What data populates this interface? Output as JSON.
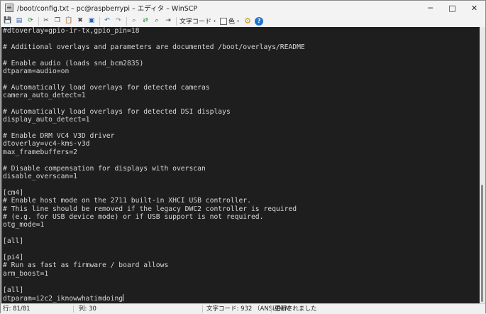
{
  "window": {
    "title": "/boot/config.txt – pc@raspberrypi – エディタ – WinSCP",
    "minimize_glyph": "─",
    "maximize_glyph": "□",
    "close_glyph": "✕"
  },
  "toolbar": {
    "buttons": [
      {
        "name": "save-icon",
        "glyph": "💾"
      },
      {
        "name": "save-all-icon",
        "glyph": "▤"
      },
      {
        "name": "reload-icon",
        "glyph": "⟳"
      },
      {
        "name": "cut-icon",
        "glyph": "✂"
      },
      {
        "name": "copy-icon",
        "glyph": "❐"
      },
      {
        "name": "paste-icon",
        "glyph": "📋"
      },
      {
        "name": "delete-icon",
        "glyph": "✖"
      },
      {
        "name": "select-all-icon",
        "glyph": "▣"
      },
      {
        "name": "undo-icon",
        "glyph": "↶"
      },
      {
        "name": "redo-icon",
        "glyph": "↷"
      },
      {
        "name": "find-icon",
        "glyph": "⌕"
      },
      {
        "name": "replace-icon",
        "glyph": "⇄"
      },
      {
        "name": "find-next-icon",
        "glyph": "⌕"
      },
      {
        "name": "goto-line-icon",
        "glyph": "⇥"
      }
    ],
    "encoding_label": "文字コード・",
    "color_label": "色・",
    "settings_glyph": "⚙",
    "help_glyph": "?"
  },
  "editor": {
    "lines": [
      "#dtoverlay=gpio-ir-tx,gpio_pin=18",
      "",
      "# Additional overlays and parameters are documented /boot/overlays/README",
      "",
      "# Enable audio (loads snd_bcm2835)",
      "dtparam=audio=on",
      "",
      "# Automatically load overlays for detected cameras",
      "camera_auto_detect=1",
      "",
      "# Automatically load overlays for detected DSI displays",
      "display_auto_detect=1",
      "",
      "# Enable DRM VC4 V3D driver",
      "dtoverlay=vc4-kms-v3d",
      "max_framebuffers=2",
      "",
      "# Disable compensation for displays with overscan",
      "disable_overscan=1",
      "",
      "[cm4]",
      "# Enable host mode on the 2711 built-in XHCI USB controller.",
      "# This line should be removed if the legacy DWC2 controller is required",
      "# (e.g. for USB device mode) or if USB support is not required.",
      "otg_mode=1",
      "",
      "[all]",
      "",
      "[pi4]",
      "# Run as fast as firmware / board allows",
      "arm_boost=1",
      "",
      "[all]",
      "dtparam=i2c2_iknowwhatimdoing"
    ]
  },
  "status": {
    "line": "行: 81/81",
    "column": "列: 30",
    "encoding": "文字コード: 932 （ANSI/OEM",
    "modified": "更新されました"
  }
}
